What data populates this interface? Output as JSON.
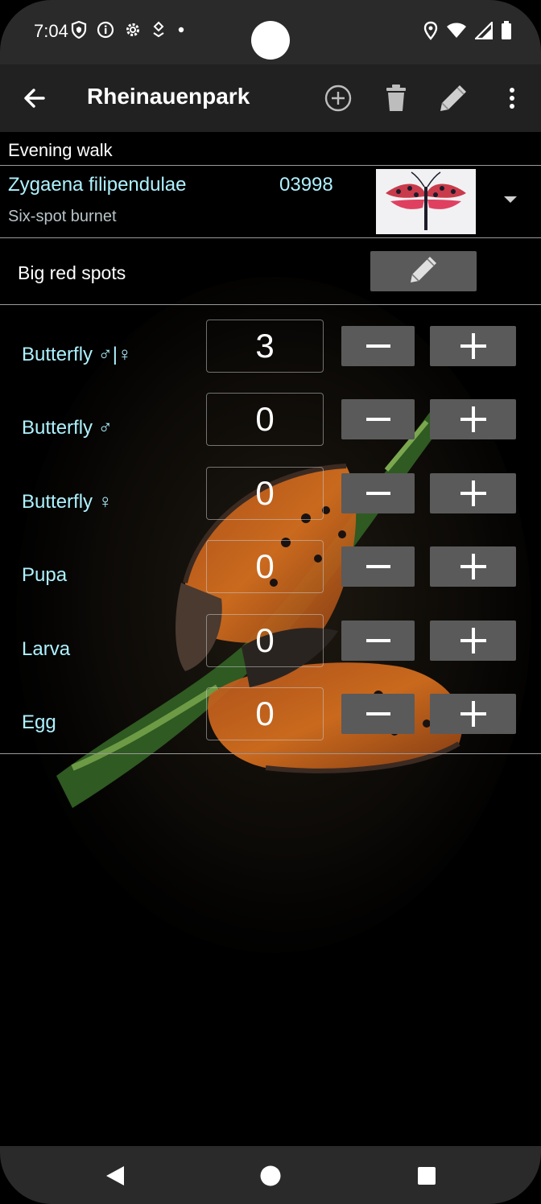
{
  "status_bar": {
    "time": "7:04",
    "left_icons": [
      "vpn-shield-icon",
      "info-icon",
      "settings-gear-icon",
      "location-sharing-icon",
      "notification-dot-icon"
    ],
    "right_icons": [
      "location-pin-icon",
      "wifi-icon",
      "signal-icon",
      "battery-icon"
    ]
  },
  "app_bar": {
    "title": "Rheinauenpark",
    "actions": [
      "add-icon",
      "delete-icon",
      "edit-icon",
      "more-icon"
    ]
  },
  "walk": {
    "label": "Evening walk"
  },
  "species": {
    "scientific_name": "Zygaena filipendulae",
    "code": "03998",
    "common_name": "Six-spot burnet"
  },
  "note": {
    "text": "Big red spots"
  },
  "counters": [
    {
      "label": "Butterfly ♂|♀",
      "value": "3",
      "minus": "−",
      "plus": "+"
    },
    {
      "label": "Butterfly ♂",
      "value": "0",
      "minus": "−",
      "plus": "+"
    },
    {
      "label": "Butterfly ♀",
      "value": "0",
      "minus": "−",
      "plus": "+"
    },
    {
      "label": "Pupa",
      "value": "0",
      "minus": "−",
      "plus": "+"
    },
    {
      "label": "Larva",
      "value": "0",
      "minus": "−",
      "plus": "+"
    },
    {
      "label": "Egg",
      "value": "0",
      "minus": "−",
      "plus": "+"
    }
  ],
  "colors": {
    "accent_text": "#aef2ff",
    "button_bg": "#5a5a5a",
    "app_bar_bg": "#212121"
  }
}
